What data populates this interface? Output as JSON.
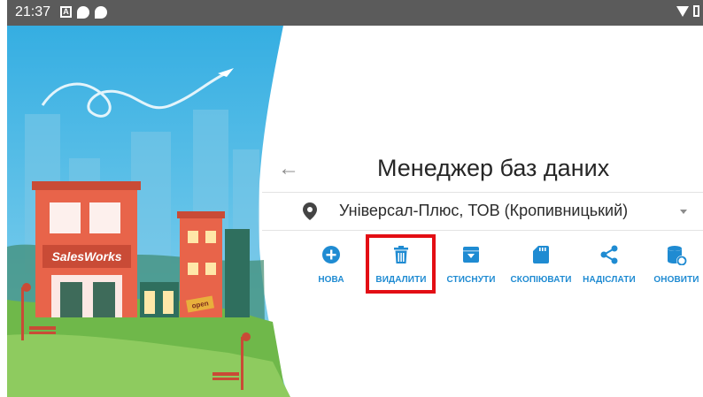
{
  "status_bar": {
    "time": "21:37",
    "notification_badge": "A"
  },
  "header": {
    "title": "Менеджер баз даних"
  },
  "location": {
    "name": "Універсал-Плюс, ТОВ (Кропивницький)"
  },
  "illustration": {
    "store_sign": "SalesWorks",
    "open_sign": "open"
  },
  "actions": [
    {
      "label": "НОВА",
      "icon": "add-circle-icon"
    },
    {
      "label": "ВИДАЛИТИ",
      "icon": "trash-icon"
    },
    {
      "label": "СТИСНУТИ",
      "icon": "archive-icon"
    },
    {
      "label": "СКОПІЮВАТИ",
      "icon": "sd-card-icon"
    },
    {
      "label": "НАДІСЛАТИ",
      "icon": "share-icon"
    },
    {
      "label": "ОНОВИТИ",
      "icon": "database-refresh-icon"
    }
  ],
  "colors": {
    "accent": "#1f8bd2",
    "highlight": "#e30e14",
    "status_bar": "#5b5b5b",
    "sky": "#3fb6e4",
    "grass": "#6fb84a",
    "building": "#e8644a"
  }
}
